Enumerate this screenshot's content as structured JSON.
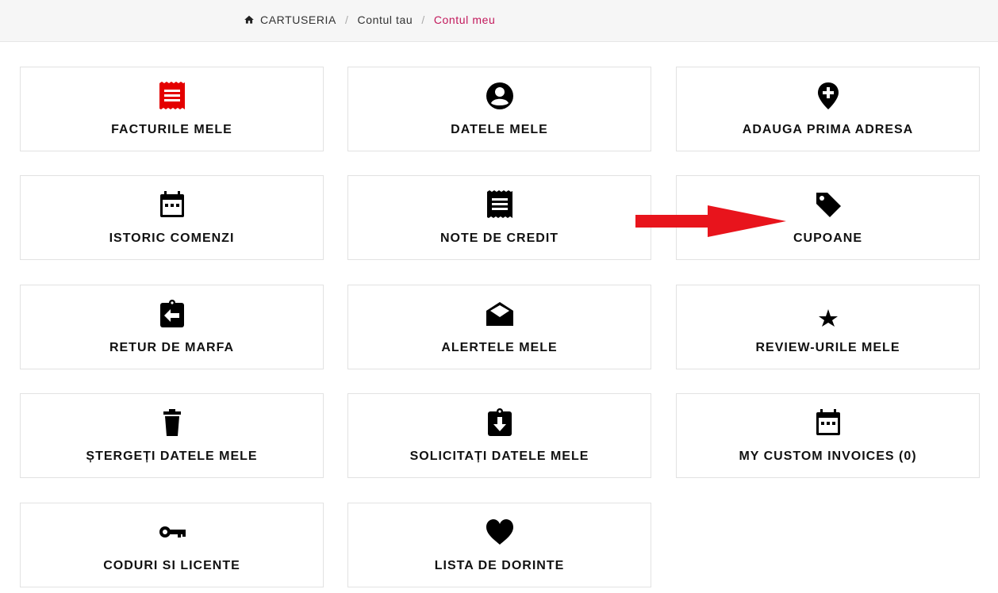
{
  "breadcrumb": {
    "home": "CARTUSERIA",
    "sep1": "/",
    "parent": "Contul tau",
    "sep2": "/",
    "current": "Contul meu"
  },
  "cards": [
    {
      "label": "FACTURILE MELE",
      "icon": "invoice-icon",
      "icon_color": "#e40000"
    },
    {
      "label": "DATELE MELE",
      "icon": "user-circle-icon",
      "icon_color": "#000000"
    },
    {
      "label": "ADAUGA PRIMA ADRESA",
      "icon": "add-location-icon",
      "icon_color": "#000000"
    },
    {
      "label": "ISTORIC COMENZI",
      "icon": "calendar-icon",
      "icon_color": "#000000"
    },
    {
      "label": "NOTE DE CREDIT",
      "icon": "receipt-icon",
      "icon_color": "#000000"
    },
    {
      "label": "CUPOANE",
      "icon": "tag-icon",
      "icon_color": "#000000"
    },
    {
      "label": "RETUR DE MARFA",
      "icon": "clipboard-return-icon",
      "icon_color": "#000000"
    },
    {
      "label": "ALERTELE MELE",
      "icon": "open-envelope-icon",
      "icon_color": "#000000"
    },
    {
      "label": "REVIEW-URILE MELE",
      "icon": "star-icon",
      "icon_color": "#000000"
    },
    {
      "label": "ȘTERGEȚI DATELE MELE",
      "icon": "trash-icon",
      "icon_color": "#000000"
    },
    {
      "label": "SOLICITAȚI DATELE MELE",
      "icon": "clipboard-download-icon",
      "icon_color": "#000000"
    },
    {
      "label": "MY CUSTOM INVOICES (0)",
      "icon": "calendar-icon",
      "icon_color": "#000000"
    },
    {
      "label": "CODURI SI LICENTE",
      "icon": "key-icon",
      "icon_color": "#000000"
    },
    {
      "label": "LISTA DE DORINTE",
      "icon": "heart-icon",
      "icon_color": "#000000"
    }
  ],
  "annotation": {
    "icon": "red-arrow-icon",
    "color": "#e8141c"
  },
  "colors": {
    "accent": "#c2185b"
  }
}
